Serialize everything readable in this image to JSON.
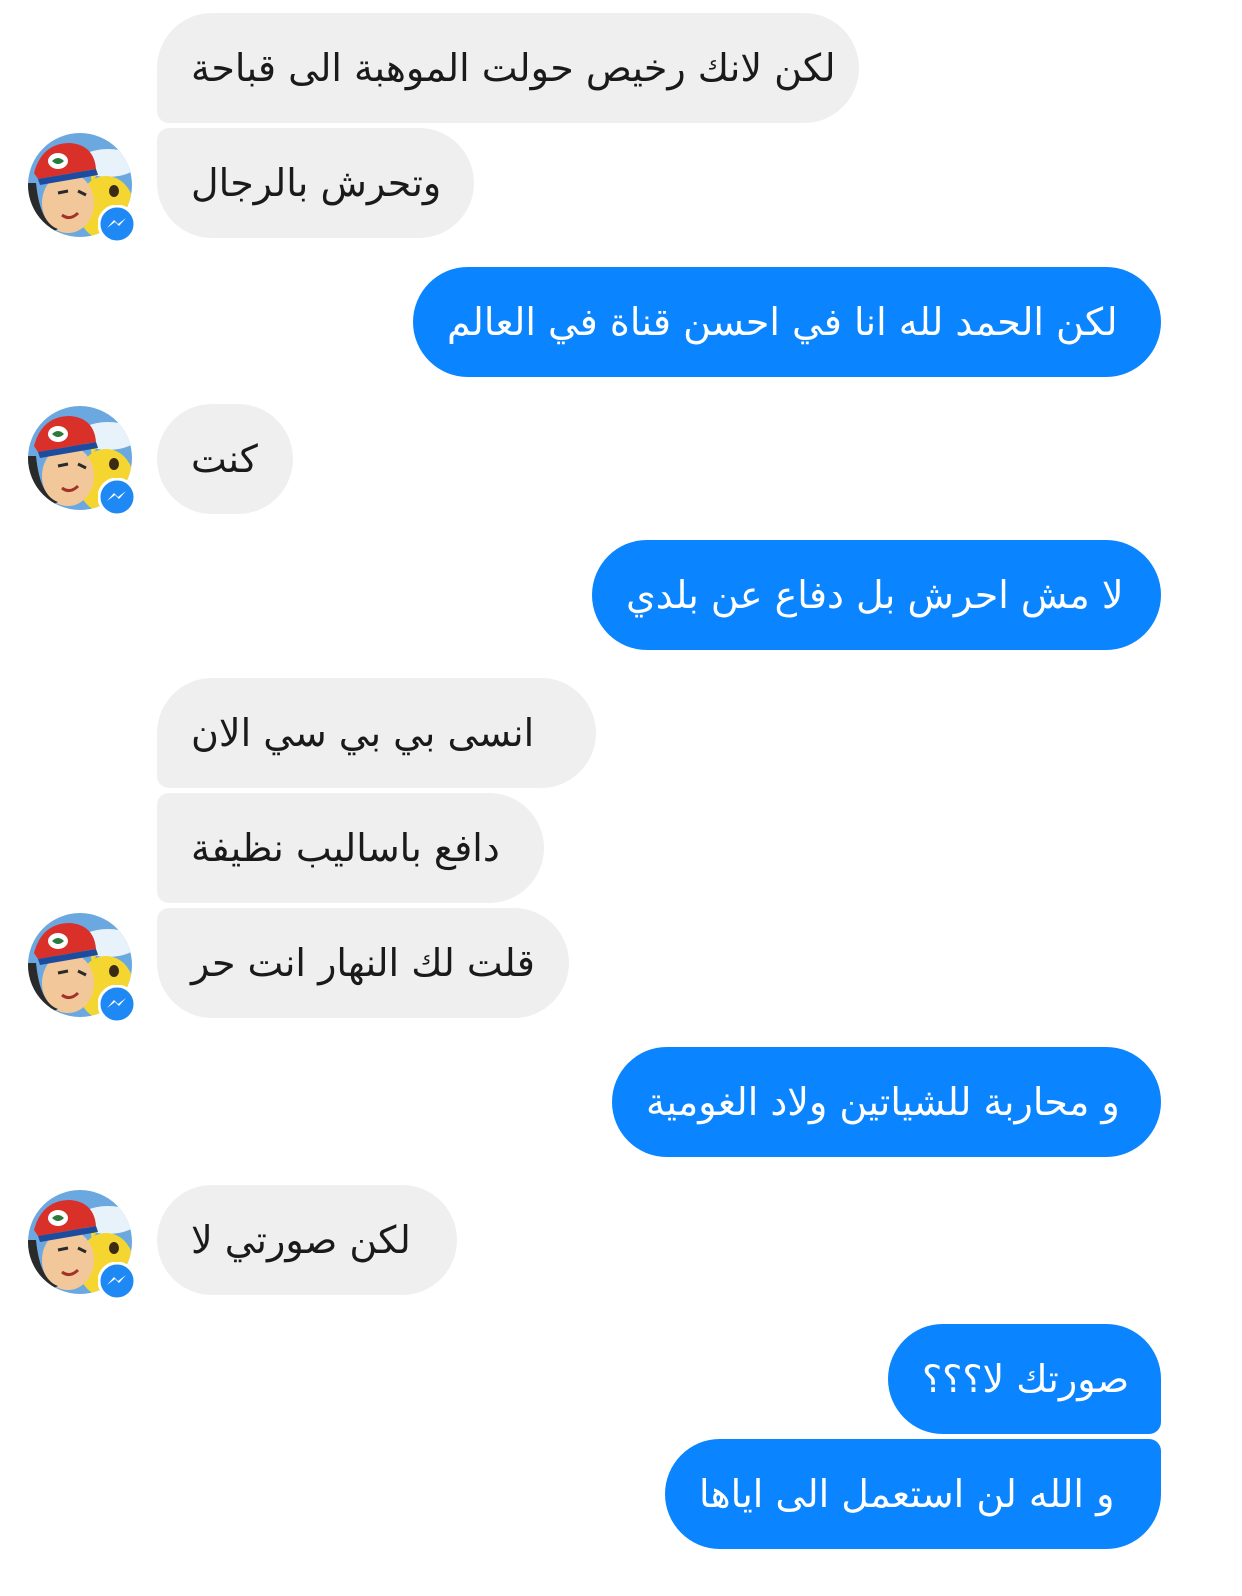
{
  "conversation": {
    "messages": [
      {
        "sender": "contact",
        "text": "لكن لانك رخيص حولت الموهبة الى قباحة"
      },
      {
        "sender": "contact",
        "text": "وتحرش بالرجال"
      },
      {
        "sender": "me",
        "text": "لكن الحمد لله انا في احسن قناة في العالم"
      },
      {
        "sender": "contact",
        "text": "كنت"
      },
      {
        "sender": "me",
        "text": "لا مش احرش بل دفاع عن بلدي"
      },
      {
        "sender": "contact",
        "text": "انسى بي بي سي الان"
      },
      {
        "sender": "contact",
        "text": "دافع باساليب نظيفة"
      },
      {
        "sender": "contact",
        "text": "قلت لك النهار انت حر"
      },
      {
        "sender": "me",
        "text": "و محاربة للشياتين ولاد الغومية"
      },
      {
        "sender": "contact",
        "text": "لكن صورتي لا"
      },
      {
        "sender": "me",
        "text": "صورتك لا؟؟؟"
      },
      {
        "sender": "me",
        "text": "و الله لن استعمل الى اياها"
      }
    ]
  },
  "avatar": {
    "icon": "contact-avatar-icon",
    "badge_icon": "messenger-badge-icon"
  },
  "colors": {
    "outgoing_bubble": "#0a84ff",
    "incoming_bubble": "#f0eff0",
    "outgoing_text": "#ffffff",
    "incoming_text": "#1a1a1a",
    "badge": "#1e88f5"
  }
}
